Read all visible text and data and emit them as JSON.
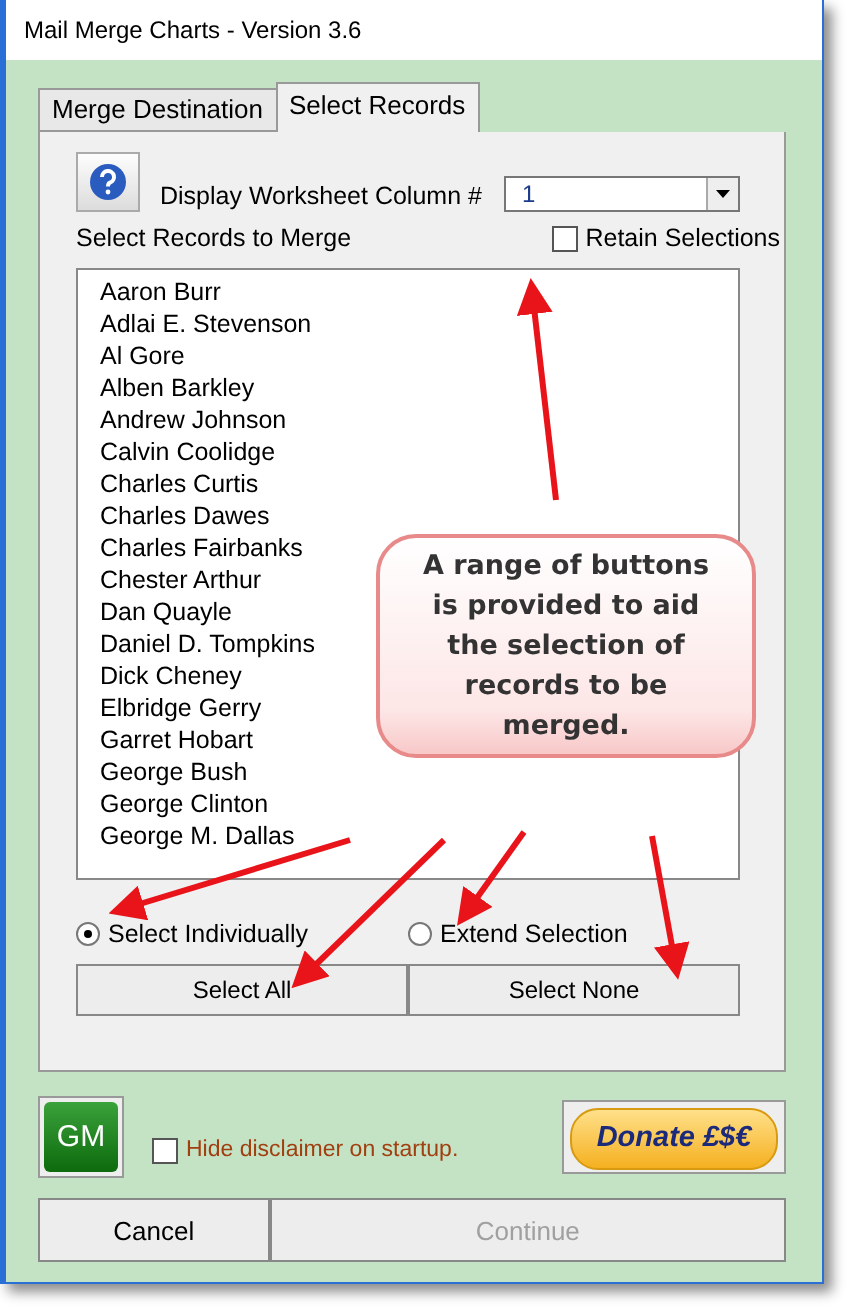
{
  "window": {
    "title": "Mail Merge Charts - Version 3.6"
  },
  "tabs": [
    {
      "label": "Merge Destination",
      "selected": false
    },
    {
      "label": "Select Records",
      "selected": true
    }
  ],
  "column_select": {
    "label": "Display Worksheet Column #",
    "value": "1"
  },
  "records_label": "Select Records to Merge",
  "retain_selections": {
    "label": "Retain Selections",
    "checked": false
  },
  "records": [
    "Aaron Burr",
    "Adlai E. Stevenson",
    "Al Gore",
    "Alben Barkley",
    "Andrew Johnson",
    "Calvin Coolidge",
    "Charles Curtis",
    "Charles Dawes",
    "Charles Fairbanks",
    "Chester Arthur",
    "Dan Quayle",
    "Daniel D. Tompkins",
    "Dick Cheney",
    "Elbridge Gerry",
    "Garret Hobart",
    "George Bush",
    "George Clinton",
    "George M. Dallas"
  ],
  "selection_modes": [
    {
      "label": "Select Individually",
      "selected": true
    },
    {
      "label": "Extend Selection",
      "selected": false
    }
  ],
  "selection_buttons": [
    "Select All",
    "Select None"
  ],
  "logo_button": "GM",
  "hide_disclaimer": {
    "label": "Hide disclaimer on startup.",
    "checked": false
  },
  "donate_button": "Donate £$€",
  "footer_buttons": [
    {
      "label": "Cancel",
      "disabled": false
    },
    {
      "label": "Continue",
      "disabled": true
    }
  ],
  "callout": {
    "text": "A range of buttons is provided to aid the selection of records to be merged."
  }
}
